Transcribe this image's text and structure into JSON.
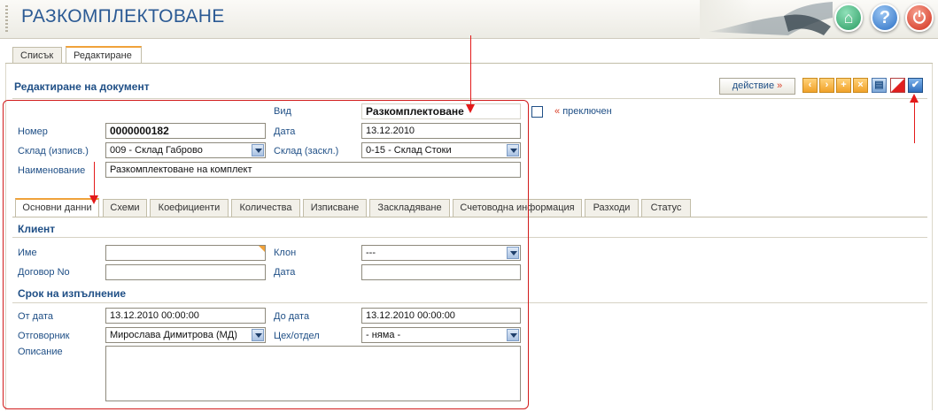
{
  "header": {
    "title": "РАЗКОМПЛЕКТОВАНЕ",
    "buttons": [
      "home-icon",
      "help-icon",
      "power-icon"
    ]
  },
  "tabs": [
    {
      "label": "Списък"
    },
    {
      "label": "Редактиране",
      "active": true
    }
  ],
  "document": {
    "heading": "Редактиране на документ",
    "action_label": "действие",
    "action_suffix": "»",
    "toolbar": [
      "prev-icon",
      "next-icon",
      "add-icon",
      "delete-icon",
      "print-icon",
      "flag-icon",
      "confirm-icon"
    ]
  },
  "form": {
    "vid": {
      "label": "Вид",
      "value": "Разкомплектоване"
    },
    "toggle": {
      "prefix": "«",
      "label": "преключен",
      "checked": false
    },
    "nomer": {
      "label": "Номер",
      "value": "0000000182"
    },
    "data": {
      "label": "Дата",
      "value": "13.12.2010"
    },
    "sklad_out": {
      "label": "Склад (изписв.)",
      "value": "009 - Склад Габрово"
    },
    "sklad_in": {
      "label": "Склад (заскл.)",
      "value": "0-15 - Склад Стоки"
    },
    "naimenovanie": {
      "label": "Наименование",
      "value": "Разкомплектоване на комплект"
    }
  },
  "inner_tabs": [
    {
      "label": "Основни данни",
      "active": true
    },
    {
      "label": "Схеми"
    },
    {
      "label": "Коефициенти"
    },
    {
      "label": "Количества"
    },
    {
      "label": "Изписване"
    },
    {
      "label": "Заскладяване"
    },
    {
      "label": "Счетоводна информация"
    },
    {
      "label": "Разходи"
    },
    {
      "label": "Статус"
    }
  ],
  "client": {
    "section": "Клиент",
    "name": {
      "label": "Име",
      "value": ""
    },
    "branch": {
      "label": "Клон",
      "value": "---"
    },
    "contract": {
      "label": "Договор No",
      "value": ""
    },
    "date": {
      "label": "Дата",
      "value": ""
    }
  },
  "deadline": {
    "section": "Срок на изпълнение",
    "from": {
      "label": "От дата",
      "value": "13.12.2010 00:00:00"
    },
    "to": {
      "label": "До дата",
      "value": "13.12.2010 00:00:00"
    },
    "responsible": {
      "label": "Отговорник",
      "value": "Мирослава Димитрова (МД)"
    },
    "dept": {
      "label": "Цех/отдел",
      "value": "- няма -"
    },
    "description": {
      "label": "Описание",
      "value": ""
    }
  },
  "colors": {
    "accent": "#1f4f86",
    "tab_highlight": "#f0a23a",
    "annotation": "#e31a1a"
  }
}
